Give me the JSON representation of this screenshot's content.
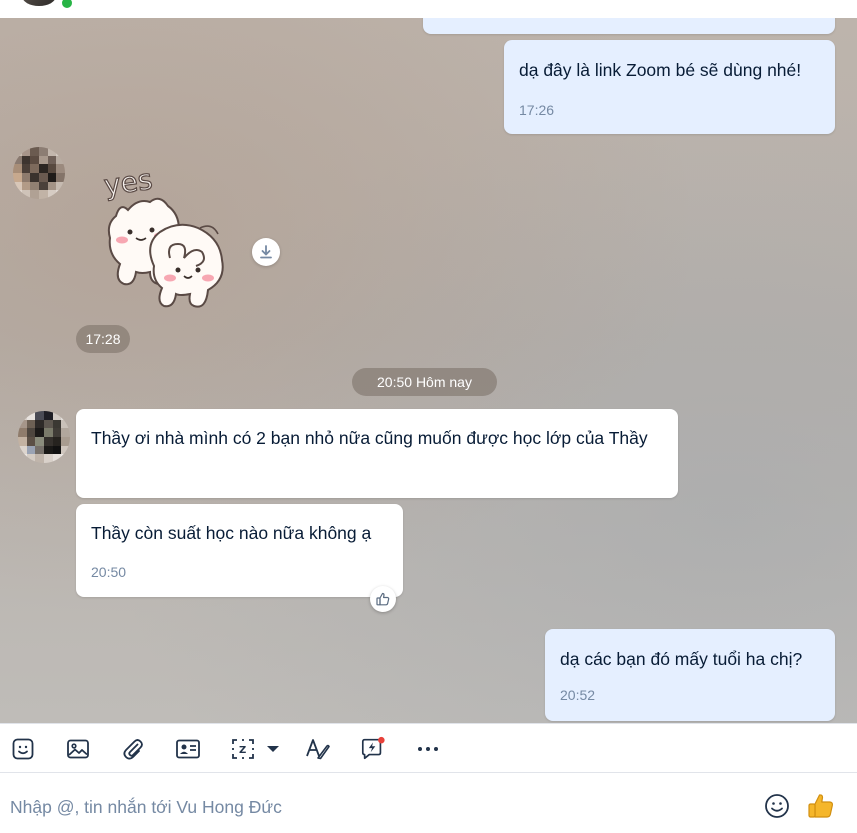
{
  "chat": {
    "messages": [
      {
        "direction": "out",
        "text": "dạ đây là link Zoom bé sẽ dùng nhé!",
        "time": "17:26"
      },
      {
        "direction": "in",
        "type": "sticker",
        "sticker_text": "yes",
        "time": "17:28"
      },
      {
        "direction": "in",
        "text": "Thầy ơi nhà mình có 2 bạn nhỏ nữa cũng muốn được học lớp của Thầy"
      },
      {
        "direction": "in",
        "text": "Thầy còn suất học nào nữa không ạ",
        "time": "20:50"
      },
      {
        "direction": "out",
        "text": "dạ các bạn đó mấy tuổi ha chị?",
        "time": "20:52"
      }
    ],
    "date_separator": "20:50 Hôm nay"
  },
  "toolbar": {
    "icons": [
      "sticker-icon",
      "image-icon",
      "attachment-icon",
      "contact-card-icon",
      "screenshot-icon",
      "dropdown-arrow-icon",
      "text-format-icon",
      "quick-message-icon",
      "more-icon"
    ]
  },
  "composer": {
    "placeholder": "Nhập @, tin nhắn tới Vu Hong Đức"
  },
  "colors": {
    "outgoing_bubble": "#e5efff",
    "incoming_bubble": "#ffffff",
    "accent_red": "#e8413a",
    "like_yellow": "#f5b62a"
  }
}
